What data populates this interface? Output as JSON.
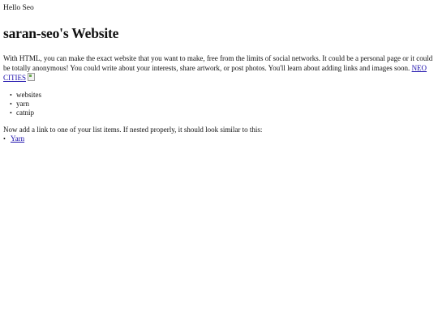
{
  "greeting": "Hello Seo",
  "title": "saran-seo's Website",
  "intro": {
    "text": "With HTML, you can make the exact website that you want to make, free from the limits of social networks. It could be a personal page or it could be totally anonymous! You could write about your interests, share artwork, or post photos. You'll learn about adding links and images soon.",
    "link_label": "NEO CITIES"
  },
  "interests": [
    "websites",
    "yarn",
    "catnip"
  ],
  "note": "Now add a link to one of your list items. If nested properly, it should look similar to this:",
  "example_list": [
    {
      "label": "Yarn"
    }
  ],
  "bullet_glyph": "•",
  "colors": {
    "link": "#1a0dab",
    "text": "#111111",
    "background": "#ffffff"
  }
}
